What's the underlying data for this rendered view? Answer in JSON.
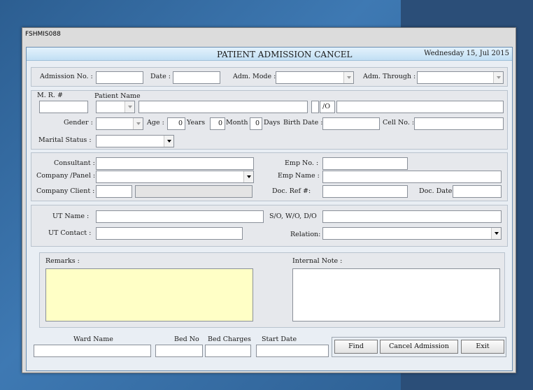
{
  "window": {
    "title": "FSHMIS088"
  },
  "header": {
    "title": "PATIENT ADMISSION CANCEL",
    "date": "Wednesday 15, Jul 2015"
  },
  "admission": {
    "no_label": "Admission No. :",
    "date_label": "Date :",
    "mode_label": "Adm. Mode :",
    "through_label": "Adm. Through :"
  },
  "patient": {
    "mr_label": "M. R. #",
    "name_label": "Patient Name",
    "relation_sep": "/O",
    "gender_label": "Gender :",
    "age_label": "Age :",
    "years_value": "0",
    "years_label": "Years",
    "month_value": "0",
    "month_label": "Month",
    "days_value": "0",
    "days_label": "Days",
    "birth_label": "Birth Date :",
    "cell_label": "Cell No. :",
    "marital_label": "Marital Status :"
  },
  "consult": {
    "consultant_label": "Consultant :",
    "company_label": "Company /Panel :",
    "client_label": "Company Client :",
    "empno_label": "Emp No. :",
    "empname_label": "Emp Name :",
    "docref_label": "Doc. Ref #:",
    "docdate_label": "Doc. Date :"
  },
  "ut": {
    "name_label": "UT Name :",
    "swd_label": "S/O, W/O, D/O",
    "contact_label": "UT Contact :",
    "relation_label": "Relation:"
  },
  "notes": {
    "remarks_label": "Remarks :",
    "internal_label": "Internal Note :"
  },
  "ward": {
    "ward_label": "Ward Name",
    "bed_label": "Bed No",
    "charges_label": "Bed Charges",
    "start_label": "Start Date"
  },
  "buttons": {
    "find": "Find",
    "cancel": "Cancel Admission",
    "exit": "Exit"
  }
}
